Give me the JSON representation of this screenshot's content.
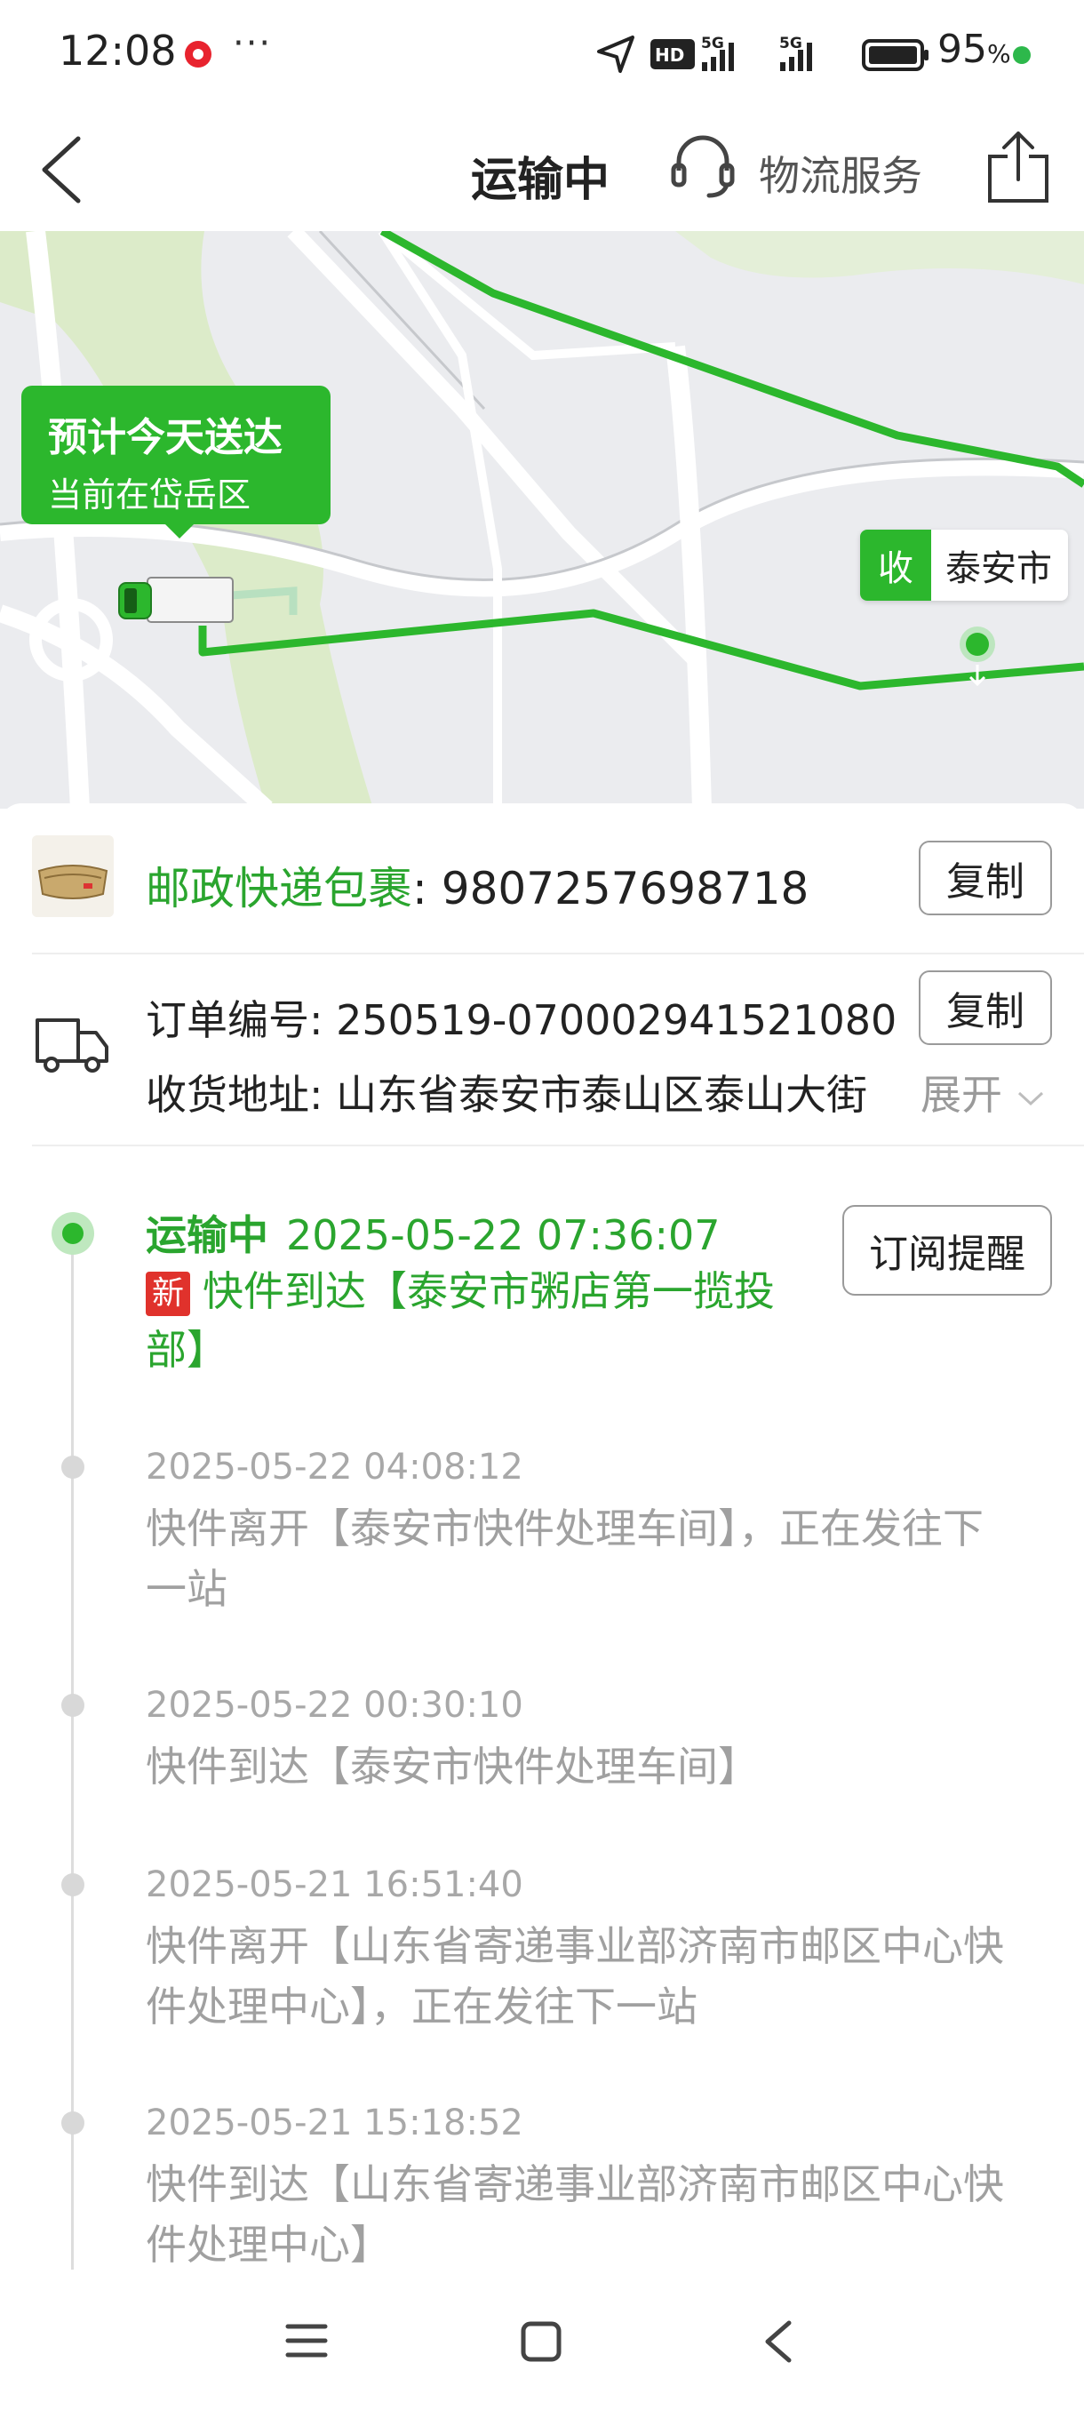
{
  "status_bar": {
    "time": "12:08",
    "battery": "95",
    "battery_unit": "%"
  },
  "nav": {
    "title": "运输中",
    "service_label": "物流服务"
  },
  "map": {
    "eta_title": "预计今天送达",
    "eta_sub": "当前在岱岳区",
    "dest_badge": "收",
    "dest_city": "泰安市"
  },
  "package": {
    "carrier": "邮政快递包裹",
    "separator": ":",
    "tracking_no": "9807257698718",
    "copy_label": "复制"
  },
  "order": {
    "order_label": "订单编号: ",
    "order_no": "250519-070002941521080",
    "copy_label": "复制",
    "address_label": "收货地址: ",
    "address": "山东省泰安市泰山区泰山大街",
    "expand_label": "展开"
  },
  "timeline": {
    "subscribe_label": "订阅提醒",
    "current": {
      "status": "运输中",
      "time": "2025-05-22 07:36:07",
      "badge": "新",
      "desc": "快件到达【泰安市粥店第一揽投部】"
    },
    "events": [
      {
        "time": "2025-05-22 04:08:12",
        "desc": "快件离开【泰安市快件处理车间】，正在发往下一站"
      },
      {
        "time": "2025-05-22 00:30:10",
        "desc": "快件到达【泰安市快件处理车间】"
      },
      {
        "time": "2025-05-21 16:51:40",
        "desc": "快件离开【山东省寄递事业部济南市邮区中心快件处理中心】，正在发往下一站"
      },
      {
        "time": "2025-05-21 15:18:52",
        "desc": "快件到达【山东省寄递事业部济南市邮区中心快件处理中心】"
      }
    ]
  },
  "colors": {
    "accent": "#2cb72d",
    "accent_text": "#2aa52e",
    "new_badge": "#e0322c"
  }
}
